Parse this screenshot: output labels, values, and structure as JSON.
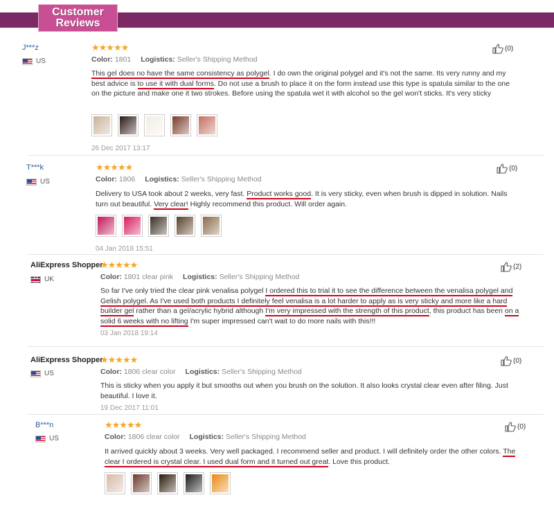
{
  "header": {
    "badge_line1": "Customer",
    "badge_line2": "Reviews"
  },
  "colors": {
    "band": "#7b2a66",
    "badge": "#c94f95",
    "star": "#f5a623",
    "underline": "#d0021b",
    "name_link": "#2e5c9e"
  },
  "labels": {
    "color": "Color:",
    "logistics": "Logistics:"
  },
  "reviews": [
    {
      "name": "J***z",
      "country": "US",
      "flag": "us",
      "stars": "★★★★★",
      "color": "1801",
      "logistics": "Seller's Shipping Method",
      "likes": "(0)",
      "body_segments": [
        {
          "t": "This gel does no have the same consistency as polygel",
          "u": true
        },
        {
          "t": ". I do own the original polygel and it's not the same. Its very runny and my best advice is ",
          "u": false
        },
        {
          "t": "to use it with dual forms",
          "u": true
        },
        {
          "t": ". Do not use a brush to place it on the form instead use this type is spatula similar to the one on the picture and make one it two strokes. Before using the spatula wet it with alcohol so the gel won't sticks. It's very sticky",
          "u": false
        }
      ],
      "photos": [
        "photo-1",
        "photo-2",
        "photo-3",
        "photo-4",
        "photo-5"
      ],
      "date": "26 Dec 2017 13:17"
    },
    {
      "name": "T***k",
      "country": "US",
      "flag": "us",
      "stars": "★★★★★",
      "color": "1806",
      "logistics": "Seller's Shipping Method",
      "likes": "(0)",
      "body_segments": [
        {
          "t": "Delivery to USA took about 2 weeks, very fast. ",
          "u": false
        },
        {
          "t": "Product works good",
          "u": true
        },
        {
          "t": ". It is very sticky, even when brush is dipped in solution. Nails turn out beautiful. ",
          "u": false
        },
        {
          "t": "Very clear!",
          "u": true
        },
        {
          "t": " Highly recommend this product. Will order again.",
          "u": false
        }
      ],
      "photos": [
        "photo-1",
        "photo-2",
        "photo-3",
        "photo-4",
        "photo-5"
      ],
      "date": "04 Jan 2018 15:51"
    },
    {
      "name": "AliExpress Shopper",
      "country": "UK",
      "flag": "uk",
      "stars": "★★★★★",
      "color": "1801 clear pink",
      "logistics": "Seller's Shipping Method",
      "likes": "(2)",
      "body_segments": [
        {
          "t": "So far I've only tried the clear pink venalisa polygel ",
          "u": false
        },
        {
          "t": "I ordered this to trial it to see the difference between the venalisa polygel and Gelish polygel. As I've used both products I definitely feel venalisa is a lot harder to apply as is very sticky and more like a hard builder gel",
          "u": true
        },
        {
          "t": " rather than a gel/acrylic hybrid although ",
          "u": false
        },
        {
          "t": "I'm very impressed with the strength of this product",
          "u": true
        },
        {
          "t": ", this product has been ",
          "u": false
        },
        {
          "t": "on a solid 6 weeks with no lifting",
          "u": true
        },
        {
          "t": " I'm super impressed can't wait to do more nails with this!!!",
          "u": false
        }
      ],
      "photos": [],
      "date": "03 Jan 2018 19:14"
    },
    {
      "name": "AliExpress Shopper",
      "country": "US",
      "flag": "us",
      "stars": "★★★★★",
      "color": "1806 clear color",
      "logistics": "Seller's Shipping Method",
      "likes": "(0)",
      "body_segments": [
        {
          "t": "This is sticky when you apply it but smooths out when you brush on the solution. It also looks crystal clear even after filing. Just beautiful. I love it.",
          "u": false
        }
      ],
      "photos": [],
      "date": "19 Dec 2017 11:01"
    },
    {
      "name": "B***n",
      "country": "US",
      "flag": "us",
      "stars": "★★★★★",
      "color": "1806 clear color",
      "logistics": "Seller's Shipping Method",
      "likes": "(0)",
      "body_segments": [
        {
          "t": "It arrived quickly about 3 weeks. Very well packaged. I recommend seller and product. I will definitely order the other colors. ",
          "u": false
        },
        {
          "t": "The clear I ordered is crystal clear. I used dual form and it turned out great",
          "u": true
        },
        {
          "t": ". Love this product.",
          "u": false
        }
      ],
      "photos": [
        "photo-1",
        "photo-2",
        "photo-3",
        "photo-4",
        "photo-5"
      ],
      "date": ""
    }
  ]
}
